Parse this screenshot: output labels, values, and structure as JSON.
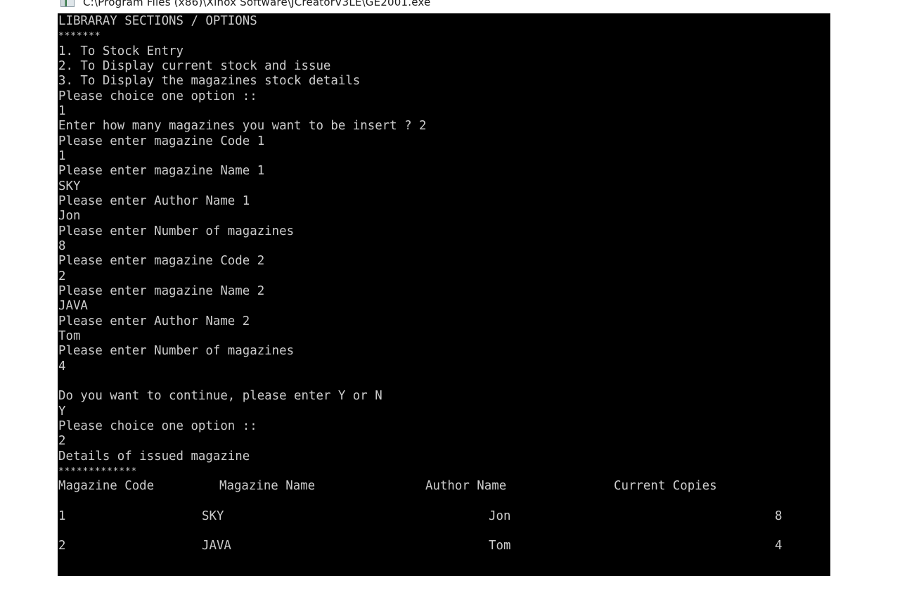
{
  "window": {
    "title": "C:\\Program Files (x86)\\Xinox Software\\JCreatorV3LE\\GE2001.exe",
    "icon": "console-app-icon"
  },
  "console": {
    "colors": {
      "background": "#000000",
      "text": "#cccccc"
    },
    "lines": [
      "LIBRARAY SECTIONS / OPTIONS",
      "*******",
      "1. To Stock Entry",
      "2. To Display current stock and issue",
      "3. To Display the magazines stock details",
      "Please choice one option ::",
      "1",
      "Enter how many magazines you want to be insert ? 2",
      "Please enter magazine Code 1",
      "1",
      "Please enter magazine Name 1",
      "SKY",
      "Please enter Author Name 1",
      "Jon",
      "Please enter Number of magazines",
      "8",
      "Please enter magazine Code 2",
      "2",
      "Please enter magazine Name 2",
      "JAVA",
      "Please enter Author Name 2",
      "Tom",
      "Please enter Number of magazines",
      "4",
      "",
      "Do you want to continue, please enter Y or N",
      "Y",
      "Please choice one option ::",
      "2",
      "Details of issued magazine",
      "*************"
    ],
    "table": {
      "headers": [
        "Magazine Code",
        "Magazine Name",
        "Author Name",
        "Current Copies"
      ],
      "rows": [
        [
          "1",
          "SKY",
          "Jon",
          "8"
        ],
        [
          "2",
          "JAVA",
          "Tom",
          "4"
        ]
      ]
    }
  }
}
